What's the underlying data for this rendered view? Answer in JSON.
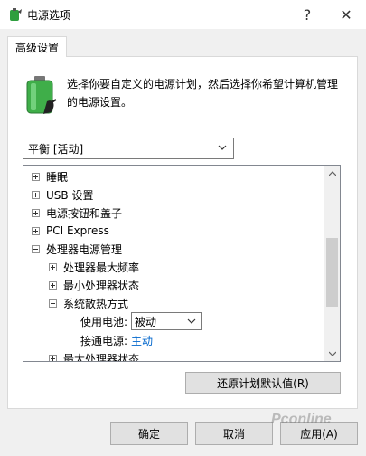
{
  "window": {
    "title": "电源选项",
    "help_glyph": "?",
    "close_glyph": "✕"
  },
  "tab": {
    "label": "高级设置"
  },
  "description": "选择你要自定义的电源计划，然后选择你希望计算机管理的电源设置。",
  "plan_select": {
    "value": "平衡 [活动]"
  },
  "tree": {
    "items": [
      {
        "label": "睡眠",
        "state": "collapsed"
      },
      {
        "label": "USB 设置",
        "state": "collapsed"
      },
      {
        "label": "电源按钮和盖子",
        "state": "collapsed"
      },
      {
        "label": "PCI Express",
        "state": "collapsed"
      },
      {
        "label": "处理器电源管理",
        "state": "expanded"
      },
      {
        "label": "处理器最大频率",
        "state": "collapsed"
      },
      {
        "label": "最小处理器状态",
        "state": "collapsed"
      },
      {
        "label": "系统散热方式",
        "state": "expanded"
      },
      {
        "label": "使用电池:",
        "value": "被动"
      },
      {
        "label": "接通电源:",
        "value": "主动"
      },
      {
        "label": "最大处理器状态",
        "state": "collapsed"
      }
    ]
  },
  "buttons": {
    "restore": "还原计划默认值(R)",
    "ok": "确定",
    "cancel": "取消",
    "apply": "应用(A)"
  },
  "watermark": "Pconline",
  "colors": {
    "link": "#0066cc",
    "battery_green": "#3fae49"
  }
}
